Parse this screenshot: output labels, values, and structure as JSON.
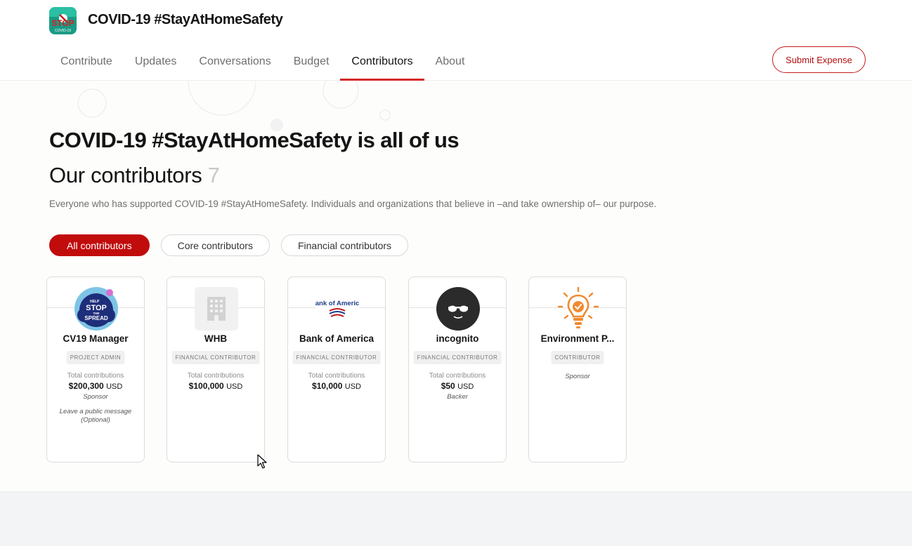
{
  "header": {
    "logo_text": "STOP",
    "logo_sub": "COVID-19",
    "collective_name": "COVID-19 #StayAtHomeSafety",
    "submit_button": "Submit Expense"
  },
  "nav": {
    "items": [
      {
        "label": "Contribute",
        "active": false
      },
      {
        "label": "Updates",
        "active": false
      },
      {
        "label": "Conversations",
        "active": false
      },
      {
        "label": "Budget",
        "active": false
      },
      {
        "label": "Contributors",
        "active": true
      },
      {
        "label": "About",
        "active": false
      }
    ]
  },
  "main": {
    "title": "COVID-19 #StayAtHomeSafety is all of us",
    "subtitle": "Our contributors",
    "count": "7",
    "description": "Everyone who has supported COVID-19 #StayAtHomeSafety. Individuals and organizations that believe in –and take ownership of– our purpose."
  },
  "filters": [
    {
      "label": "All contributors",
      "active": true
    },
    {
      "label": "Core contributors",
      "active": false
    },
    {
      "label": "Financial contributors",
      "active": false
    }
  ],
  "contributors": [
    {
      "name": "CV19 Manager",
      "role": "PROJECT ADMIN",
      "total_label": "Total contributions",
      "amount": "$200,300",
      "currency": "USD",
      "tier": "Sponsor",
      "message": "Leave a public message (Optional)",
      "avatar": "stop-the-spread-icon",
      "avatar_text": [
        "HELP",
        "STOP",
        "THE",
        "SPREAD"
      ]
    },
    {
      "name": "WHB",
      "role": "FINANCIAL CONTRIBUTOR",
      "total_label": "Total contributions",
      "amount": "$100,000",
      "currency": "USD",
      "tier": "",
      "message": "",
      "avatar": "building-icon"
    },
    {
      "name": "Bank of America",
      "role": "FINANCIAL CONTRIBUTOR",
      "total_label": "Total contributions",
      "amount": "$10,000",
      "currency": "USD",
      "tier": "",
      "message": "",
      "avatar": "bank-of-america-logo",
      "avatar_text": [
        "ank of Americ"
      ]
    },
    {
      "name": "incognito",
      "role": "FINANCIAL CONTRIBUTOR",
      "total_label": "Total contributions",
      "amount": "$50",
      "currency": "USD",
      "tier": "Backer",
      "message": "",
      "avatar": "incognito-sunglasses-icon"
    },
    {
      "name": "Environment P...",
      "role": "CONTRIBUTOR",
      "total_label": "",
      "amount": "",
      "currency": "",
      "tier": "Sponsor",
      "message": "",
      "avatar": "lightbulb-check-icon"
    }
  ],
  "colors": {
    "accent": "#c10c0c",
    "active_tab_underline": "#d32828",
    "muted_text": "#6f6f6f"
  }
}
